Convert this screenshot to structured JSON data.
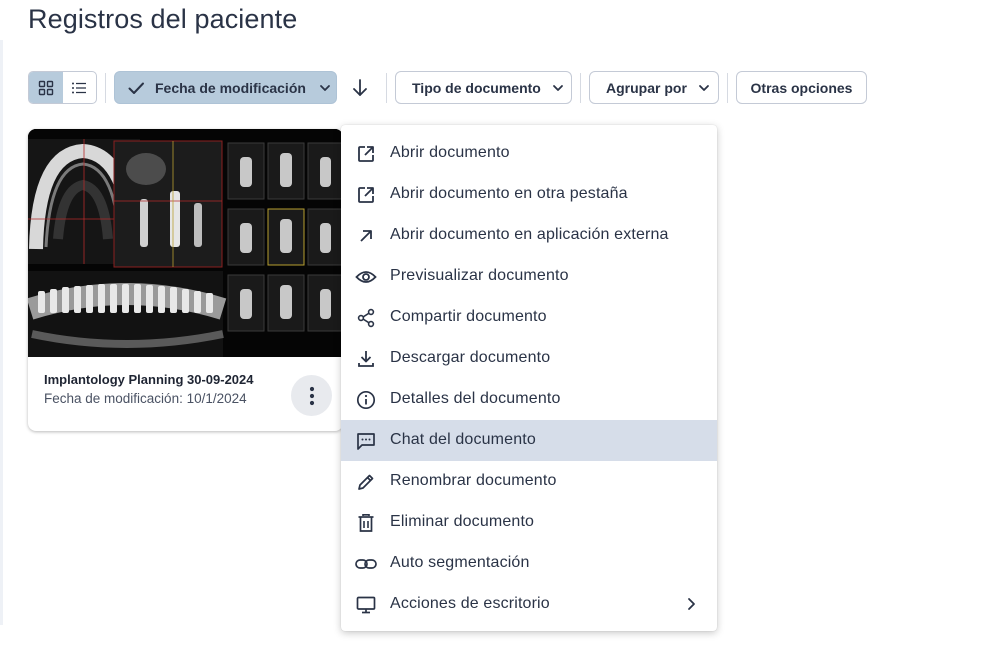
{
  "page": {
    "title": "Registros del paciente"
  },
  "toolbar": {
    "view_grid_icon": "grid-icon",
    "view_list_icon": "list-icon",
    "sort_chip_label": "Fecha de modificación",
    "sort_direction_icon": "arrow-down-icon",
    "type_filter_label": "Tipo de documento",
    "group_by_label": "Agrupar por",
    "more_options_label": "Otras opciones"
  },
  "document_card": {
    "title": "Implantology Planning 30-09-2024",
    "subtitle": "Fecha de modificación: 10/1/2024"
  },
  "context_menu": {
    "items": [
      {
        "label": "Abrir documento",
        "icon": "open-external-icon"
      },
      {
        "label": "Abrir documento en otra pestaña",
        "icon": "open-external-icon"
      },
      {
        "label": "Abrir documento en aplicación externa",
        "icon": "arrow-up-right-icon"
      },
      {
        "label": "Previsualizar documento",
        "icon": "eye-icon"
      },
      {
        "label": "Compartir documento",
        "icon": "share-icon"
      },
      {
        "label": "Descargar documento",
        "icon": "download-icon"
      },
      {
        "label": "Detalles del documento",
        "icon": "info-icon"
      },
      {
        "label": "Chat del documento",
        "icon": "chat-icon"
      },
      {
        "label": "Renombrar documento",
        "icon": "pencil-icon"
      },
      {
        "label": "Eliminar documento",
        "icon": "trash-icon"
      },
      {
        "label": "Auto segmentación",
        "icon": "link-icon"
      },
      {
        "label": "Acciones de escritorio",
        "icon": "monitor-icon"
      }
    ],
    "highlighted_index": 7
  },
  "colors": {
    "selected_chip": "#b7cbdc",
    "menu_highlight": "#d6dde9",
    "text": "#2a3346"
  }
}
